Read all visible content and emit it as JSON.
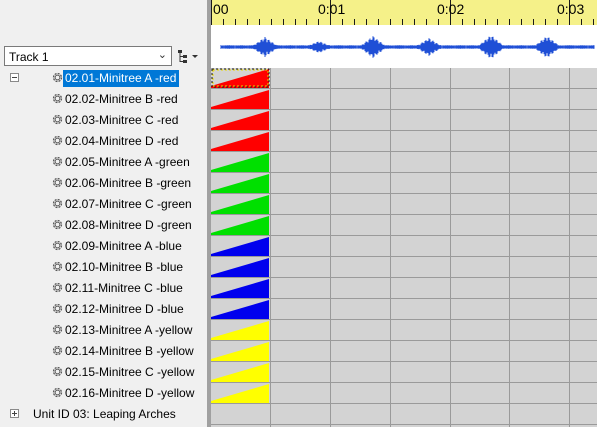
{
  "track_selector": {
    "value": "Track 1",
    "chevron_icon": "chevron-down-icon"
  },
  "hierarchy_button": {
    "icon": "hierarchy-dropdown-icon"
  },
  "tree": {
    "items": [
      {
        "label": "02.01-Minitree A -red",
        "color": "#ff0000",
        "selected": true
      },
      {
        "label": "02.02-Minitree B -red",
        "color": "#ff0000"
      },
      {
        "label": "02.03-Minitree C -red",
        "color": "#ff0000"
      },
      {
        "label": "02.04-Minitree D -red",
        "color": "#ff0000"
      },
      {
        "label": "02.05-Minitree A -green",
        "color": "#00e000"
      },
      {
        "label": "02.06-Minitree B -green",
        "color": "#00e000"
      },
      {
        "label": "02.07-Minitree C -green",
        "color": "#00e000"
      },
      {
        "label": "02.08-Minitree D -green",
        "color": "#00e000"
      },
      {
        "label": "02.09-Minitree A -blue",
        "color": "#0000ee"
      },
      {
        "label": "02.10-Minitree B -blue",
        "color": "#0000ee"
      },
      {
        "label": "02.11-Minitree C -blue",
        "color": "#0000ee"
      },
      {
        "label": "02.12-Minitree D -blue",
        "color": "#0000ee"
      },
      {
        "label": "02.13-Minitree A -yellow",
        "color": "#ffff00"
      },
      {
        "label": "02.14-Minitree B -yellow",
        "color": "#ffff00"
      },
      {
        "label": "02.15-Minitree C -yellow",
        "color": "#ffff00"
      },
      {
        "label": "02.16-Minitree D -yellow",
        "color": "#ffff00"
      }
    ],
    "collapsed_unit": {
      "label": "Unit ID 03: Leaping Arches"
    }
  },
  "timeline": {
    "labels": [
      "00",
      "0:01",
      "0:02",
      "0:03"
    ],
    "ruler_color": "#f5f189",
    "waveform_color": "#1f4fd6"
  },
  "colors": {
    "grid_background": "#d3d3d3",
    "selection": "#0078d7"
  }
}
